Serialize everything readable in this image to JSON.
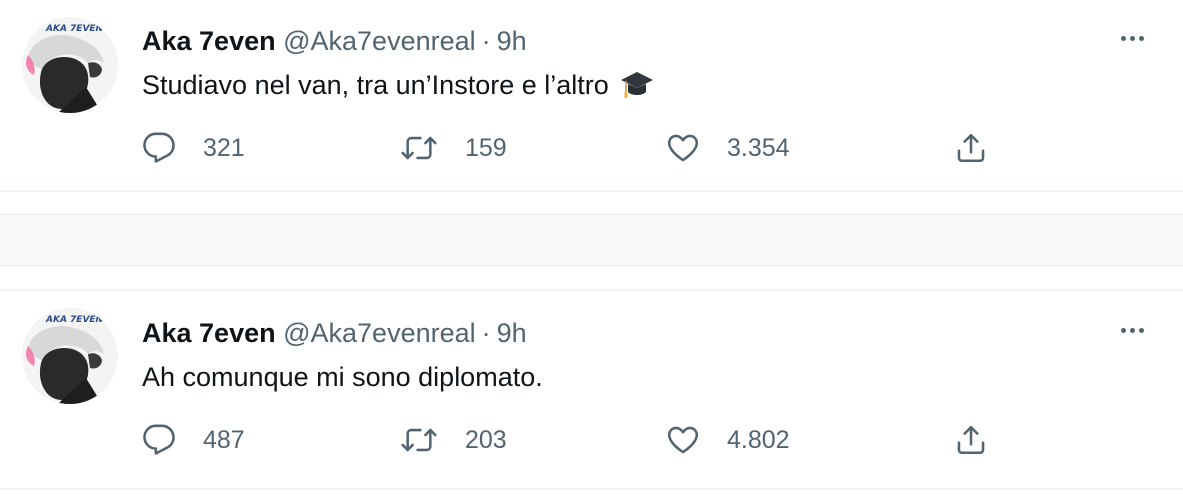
{
  "tweets": [
    {
      "author_name": "Aka 7even",
      "handle": "@Aka7evenreal",
      "separator": "·",
      "time": "9h",
      "text": "Studiavo nel van, tra un’Instore e l’altro",
      "emoji": "graduation-cap-icon",
      "avatar_text": "AKA 7EVEN",
      "replies": "321",
      "retweets": "159",
      "likes": "3.354"
    },
    {
      "author_name": "Aka 7even",
      "handle": "@Aka7evenreal",
      "separator": "·",
      "time": "9h",
      "text": "Ah comunque mi sono diplomato.",
      "avatar_text": "AKA 7EVEN",
      "replies": "487",
      "retweets": "203",
      "likes": "4.802"
    }
  ],
  "colors": {
    "text_primary": "#0f1419",
    "text_secondary": "#536471",
    "divider": "#eff3f4",
    "gap_background": "#f7f9f9"
  }
}
